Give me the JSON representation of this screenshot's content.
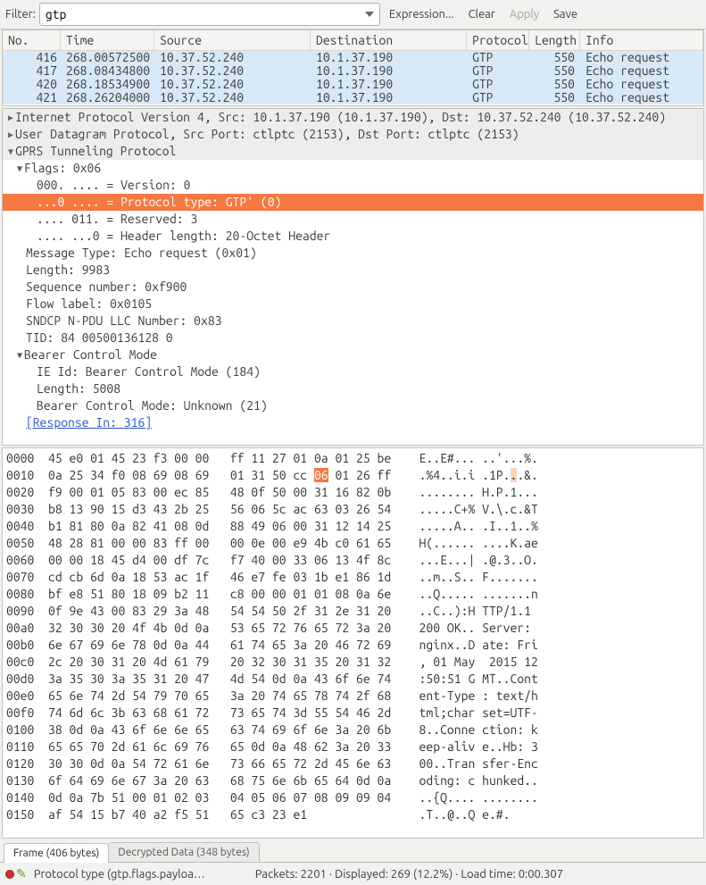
{
  "filter": {
    "label": "Filter:",
    "value": "gtp",
    "expression": "Expression...",
    "clear": "Clear",
    "apply": "Apply",
    "save": "Save"
  },
  "columns": {
    "no": "No.",
    "time": "Time",
    "source": "Source",
    "destination": "Destination",
    "protocol": "Protocol",
    "length": "Length",
    "info": "Info"
  },
  "packets": [
    {
      "no": "416",
      "time": "268.00572500",
      "src": "10.37.52.240",
      "dst": "10.1.37.190",
      "proto": "GTP",
      "len": "550",
      "info": "Echo request"
    },
    {
      "no": "417",
      "time": "268.08434800",
      "src": "10.37.52.240",
      "dst": "10.1.37.190",
      "proto": "GTP",
      "len": "550",
      "info": "Echo request"
    },
    {
      "no": "420",
      "time": "268.18534900",
      "src": "10.37.52.240",
      "dst": "10.1.37.190",
      "proto": "GTP",
      "len": "550",
      "info": "Echo request"
    },
    {
      "no": "421",
      "time": "268.26204000",
      "src": "10.37.52.240",
      "dst": "10.1.37.190",
      "proto": "GTP",
      "len": "550",
      "info": "Echo request"
    }
  ],
  "tree": {
    "ip": "Internet Protocol Version 4, Src: 10.1.37.190 (10.1.37.190), Dst: 10.37.52.240 (10.37.52.240)",
    "udp": "User Datagram Protocol, Src Port: ctlptc (2153), Dst Port: ctlptc (2153)",
    "gtp": "GPRS Tunneling Protocol",
    "flags": "Flags: 0x06",
    "version": "000. .... = Version: 0",
    "ptype": "...0 .... = Protocol type: GTP' (0)",
    "reserved": ".... 011. = Reserved: 3",
    "hlen": ".... ...0 = Header length: 20-Octet Header",
    "msgtype": "Message Type: Echo request (0x01)",
    "length": "Length: 9983",
    "seq": "Sequence number: 0xf900",
    "flow": "Flow label: 0x0105",
    "sndcp": "SNDCP N-PDU LLC Number: 0x83",
    "tid": "TID: 84 00500136128 0",
    "bcm": "Bearer Control Mode",
    "ieid": "IE Id: Bearer Control Mode (184)",
    "bcmlen": "Length: 5008",
    "bcmmode": "Bearer Control Mode: Unknown (21)",
    "response": "[Response In: 316]"
  },
  "hex": [
    {
      "off": "0000",
      "h1": "45 e0 01 45 23 f3 00 00",
      "h2": "ff 11 27 01 0a 01 25 be",
      "a": "E..E#... ..'...%."
    },
    {
      "off": "0010",
      "h1": "0a 25 34 f0 08 69 08 69",
      "h2": "01 31 50 cc ",
      "hl": "06",
      "h3": " 01 26 ff",
      "a": ".%4..i.i .1P.",
      "ahl": ".",
      "a2": ".&."
    },
    {
      "off": "0020",
      "h1": "f9 00 01 05 83 00 ec 85",
      "h2": "48 0f 50 00 31 16 82 0b",
      "a": "........ H.P.1..."
    },
    {
      "off": "0030",
      "h1": "b8 13 90 15 d3 43 2b 25",
      "h2": "56 06 5c ac 63 03 26 54",
      "a": ".....C+% V.\\.c.&T"
    },
    {
      "off": "0040",
      "h1": "b1 81 80 0a 82 41 08 0d",
      "h2": "88 49 06 00 31 12 14 25",
      "a": ".....A.. .I..1..%"
    },
    {
      "off": "0050",
      "h1": "48 28 81 00 00 83 ff 00",
      "h2": "00 0e 00 e9 4b c0 61 65",
      "a": "H(...... ....K.ae"
    },
    {
      "off": "0060",
      "h1": "00 00 18 45 d4 00 df 7c",
      "h2": "f7 40 00 33 06 13 4f 8c",
      "a": "...E...| .@.3..O."
    },
    {
      "off": "0070",
      "h1": "cd cb 6d 0a 18 53 ac 1f",
      "h2": "46 e7 fe 03 1b e1 86 1d",
      "a": "..m..S.. F......."
    },
    {
      "off": "0080",
      "h1": "bf e8 51 80 18 09 b2 11",
      "h2": "c8 00 00 01 01 08 0a 6e",
      "a": "..Q..... .......n"
    },
    {
      "off": "0090",
      "h1": "0f 9e 43 00 83 29 3a 48",
      "h2": "54 54 50 2f 31 2e 31 20",
      "a": "..C..):H TTP/1.1 "
    },
    {
      "off": "00a0",
      "h1": "32 30 30 20 4f 4b 0d 0a",
      "h2": "53 65 72 76 65 72 3a 20",
      "a": "200 OK.. Server: "
    },
    {
      "off": "00b0",
      "h1": "6e 67 69 6e 78 0d 0a 44",
      "h2": "61 74 65 3a 20 46 72 69",
      "a": "nginx..D ate: Fri"
    },
    {
      "off": "00c0",
      "h1": "2c 20 30 31 20 4d 61 79",
      "h2": "20 32 30 31 35 20 31 32",
      "a": ", 01 May  2015 12"
    },
    {
      "off": "00d0",
      "h1": "3a 35 30 3a 35 31 20 47",
      "h2": "4d 54 0d 0a 43 6f 6e 74",
      "a": ":50:51 G MT..Cont"
    },
    {
      "off": "00e0",
      "h1": "65 6e 74 2d 54 79 70 65",
      "h2": "3a 20 74 65 78 74 2f 68",
      "a": "ent-Type : text/h"
    },
    {
      "off": "00f0",
      "h1": "74 6d 6c 3b 63 68 61 72",
      "h2": "73 65 74 3d 55 54 46 2d",
      "a": "tml;char set=UTF-"
    },
    {
      "off": "0100",
      "h1": "38 0d 0a 43 6f 6e 6e 65",
      "h2": "63 74 69 6f 6e 3a 20 6b",
      "a": "8..Conne ction: k"
    },
    {
      "off": "0110",
      "h1": "65 65 70 2d 61 6c 69 76",
      "h2": "65 0d 0a 48 62 3a 20 33",
      "a": "eep-aliv e..Hb: 3"
    },
    {
      "off": "0120",
      "h1": "30 30 0d 0a 54 72 61 6e",
      "h2": "73 66 65 72 2d 45 6e 63",
      "a": "00..Tran sfer-Enc"
    },
    {
      "off": "0130",
      "h1": "6f 64 69 6e 67 3a 20 63",
      "h2": "68 75 6e 6b 65 64 0d 0a",
      "a": "oding: c hunked.."
    },
    {
      "off": "0140",
      "h1": "0d 0a 7b 51 00 01 02 03",
      "h2": "04 05 06 07 08 09 09 04",
      "a": "..{Q.... ........"
    },
    {
      "off": "0150",
      "h1": "af 54 15 b7 40 a2 f5 51",
      "h2": "65 c3 23 e1",
      "a": ".T..@..Q e.#."
    }
  ],
  "tabs": {
    "frame": "Frame (406 bytes)",
    "decrypted": "Decrypted Data (348 bytes)"
  },
  "status": {
    "field": "Protocol type (gtp.flags.payloa…",
    "stats": "Packets: 2201 · Displayed: 269 (12.2%)  · Load time: 0:00.307"
  }
}
